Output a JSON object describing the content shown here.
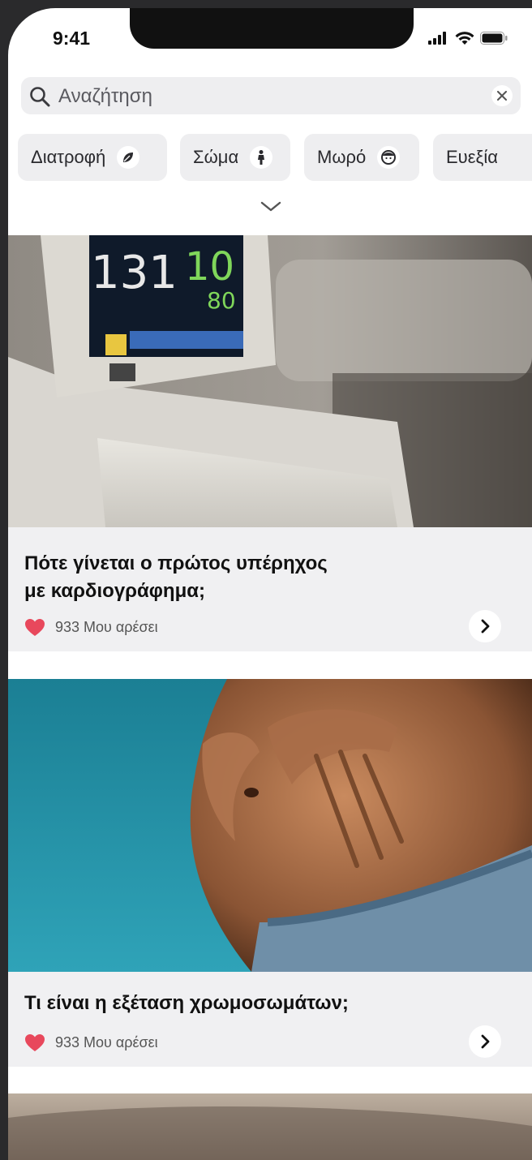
{
  "status_bar": {
    "time": "9:41"
  },
  "search": {
    "placeholder": "Αναζήτηση"
  },
  "categories": [
    {
      "label": "Διατροφή",
      "icon": "leaf-icon"
    },
    {
      "label": "Σώμα",
      "icon": "person-icon"
    },
    {
      "label": "Μωρό",
      "icon": "baby-face-icon"
    },
    {
      "label": "Ευεξία",
      "icon": ""
    }
  ],
  "articles": [
    {
      "title_line1": "Πότε γίνεται ο πρώτος υπέρηχος",
      "title_line2": "με καρδιογράφημα;",
      "likes": "933 Μου αρέσει"
    },
    {
      "title_line1": "Τι είναι η εξέταση χρωμοσωμάτων;",
      "likes": "933 Μου αρέσει"
    }
  ],
  "colors": {
    "heart": "#e8485c",
    "chip_bg": "#eeeef0",
    "card_bg": "#f0f0f2"
  }
}
